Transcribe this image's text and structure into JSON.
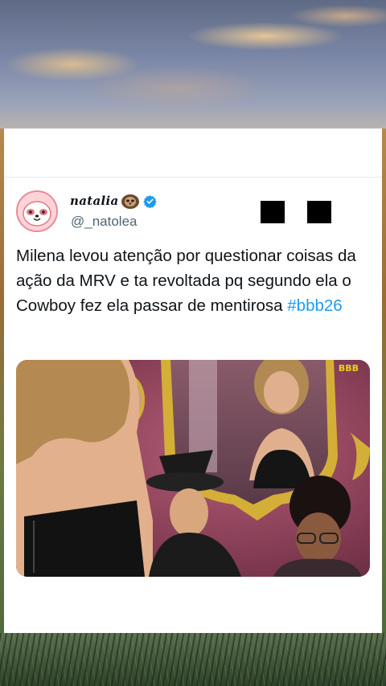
{
  "tweet": {
    "display_name": "natalia",
    "handle": "@_natolea",
    "text": "Milena levou atenção por questionar coisas da ação da MRV e ta revoltada pq segundo ela o Cowboy fez ela passar de mentirosa ",
    "hashtag": "#bbb26",
    "verified": true,
    "name_emoji": "sloth-icon",
    "avatar": "sloth-avatar"
  },
  "media": {
    "badge": "BBB"
  },
  "colors": {
    "link": "#1d9bf0",
    "verified": "#1d9bf0",
    "text": "#0f1419",
    "secondary_text": "#536471"
  }
}
